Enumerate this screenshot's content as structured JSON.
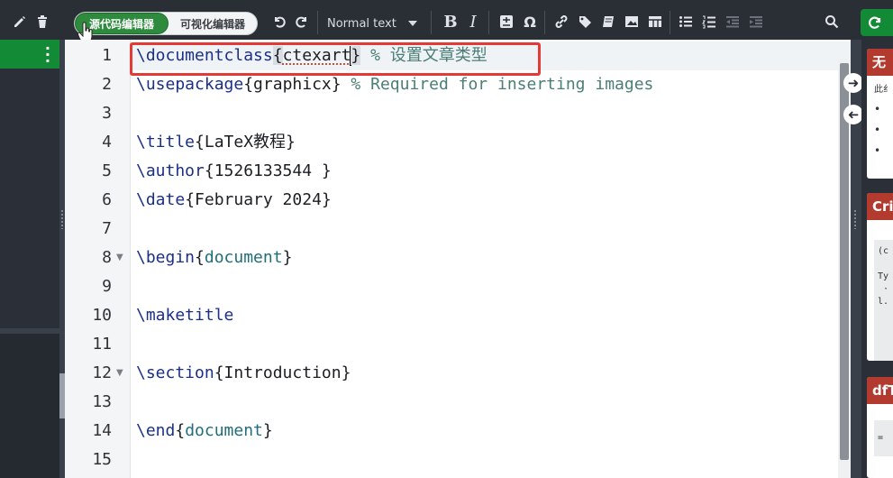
{
  "toolbar": {
    "source_editor_label": "源代码编辑器",
    "visual_editor_label": "可视化编辑器",
    "format_select_value": "Normal text",
    "recompile_icon": "refresh-icon"
  },
  "editor": {
    "line_numbers": [
      "1",
      "2",
      "3",
      "4",
      "5",
      "6",
      "7",
      "8",
      "9",
      "10",
      "11",
      "12",
      "13",
      "14",
      "15"
    ],
    "lines": {
      "l1_cmd": "\\documentclass",
      "l1_open": "{",
      "l1_arg": "ctexart",
      "l1_close": "}",
      "l1_comment": " % 设置文章类型",
      "l2_cmd": "\\usepackage",
      "l2_arg": "{graphicx}",
      "l2_comment": " % Required for inserting images",
      "l4_cmd": "\\title",
      "l4_arg": "{LaTeX教程}",
      "l5_cmd": "\\author",
      "l5_arg": "{1526133544 }",
      "l6_cmd": "\\date",
      "l6_arg": "{February 2024}",
      "l8_cmd": "\\begin",
      "l8_open": "{",
      "l8_arg": "document",
      "l8_close": "}",
      "l10_cmd": "\\maketitle",
      "l12_cmd": "\\section",
      "l12_arg": "{Introduction}",
      "l14_cmd": "\\end",
      "l14_open": "{",
      "l14_arg": "document",
      "l14_close": "}"
    }
  },
  "log_panel": {
    "card1_title": "无",
    "card1_text": "此纟",
    "card1_bullets": [
      "•",
      "•",
      "•"
    ],
    "card2_title": "Cri",
    "card2_code": "(c\n\nTy\n ·\nl.",
    "card3_title": "dfT",
    "card3_code": "="
  }
}
